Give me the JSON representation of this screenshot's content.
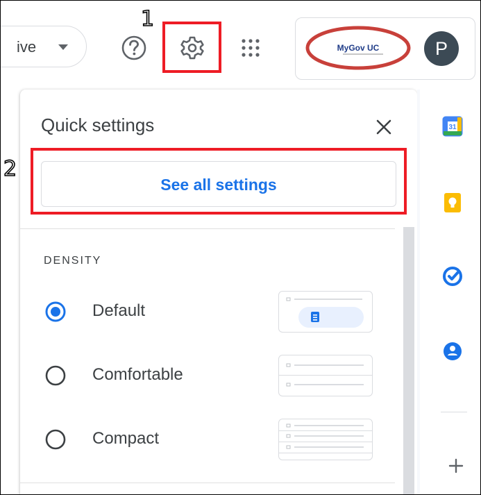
{
  "topbar": {
    "status_chip": "ive",
    "org_logo_text": "MyGov UC",
    "avatar_letter": "P"
  },
  "annotations": {
    "step1": "1",
    "step2": "2",
    "color": "#ee1c25"
  },
  "quick_settings": {
    "title": "Quick settings",
    "see_all_label": "See all settings",
    "density_heading": "DENSITY",
    "options": [
      {
        "label": "Default",
        "selected": true
      },
      {
        "label": "Comfortable",
        "selected": false
      },
      {
        "label": "Compact",
        "selected": false
      }
    ]
  },
  "side_rail": {
    "calendar_day": "31",
    "apps": [
      "calendar-icon",
      "keep-icon",
      "tasks-icon",
      "contacts-icon"
    ]
  },
  "colors": {
    "accent": "#1a73e8",
    "avatar_bg": "#3c4a55"
  }
}
